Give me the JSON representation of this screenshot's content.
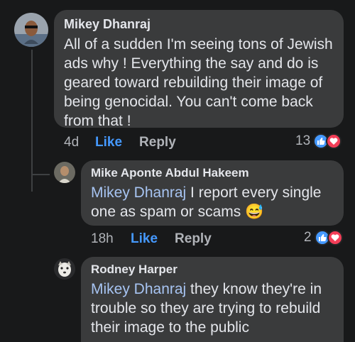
{
  "comments": [
    {
      "author": "Mikey Dhanraj",
      "text": "All of a sudden I'm seeing tons of Jewish ads  why !  Everything the say and do is geared toward rebuilding their image of being genocidal. You can't come back from that !",
      "time": "4d",
      "like_label": "Like",
      "reply_label": "Reply",
      "reaction_count": "13",
      "reactions": [
        "like-icon",
        "love-icon"
      ]
    },
    {
      "author": "Mike Aponte Abdul Hakeem",
      "mention": "Mikey Dhanraj",
      "text": " I report every single one as spam or scams",
      "emoji": "😅",
      "time": "18h",
      "like_label": "Like",
      "reply_label": "Reply",
      "reaction_count": "2",
      "reactions": [
        "like-icon",
        "love-icon"
      ]
    },
    {
      "author": "Rodney Harper",
      "mention": "Mikey Dhanraj",
      "text": " they know they're in trouble so they are trying to rebuild their image to the public"
    }
  ],
  "colors": {
    "background": "#18191a",
    "bubble": "#3a3b3c",
    "like_blue": "#4599ff",
    "mention": "#a7c4f2",
    "love_red": "#f33e58"
  }
}
